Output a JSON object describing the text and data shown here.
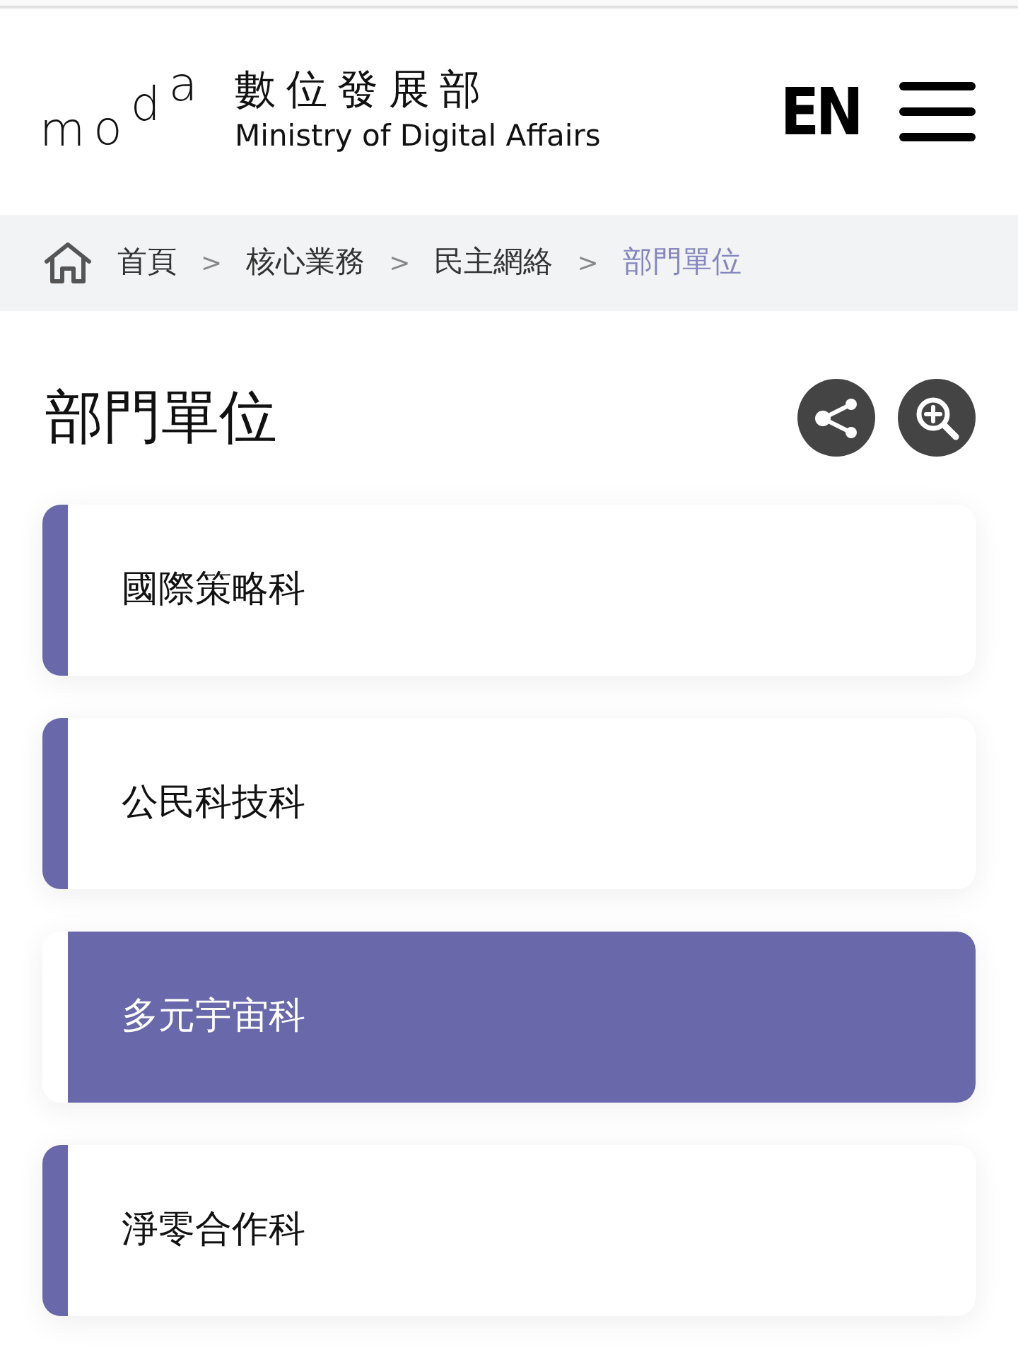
{
  "header": {
    "logo": "moda",
    "title": "數位發展部",
    "subtitle": "Ministry of Digital Affairs",
    "language": "EN"
  },
  "breadcrumb": [
    {
      "label": "首頁",
      "current": false
    },
    {
      "separator": ">",
      "label": "核心業務",
      "current": false
    },
    {
      "separator": ">",
      "label": "民主網絡",
      "current": false
    },
    {
      "separator": ">",
      "label": "部門單位",
      "current": true
    }
  ],
  "page_title": "部門單位",
  "units": [
    {
      "label": "國際策略科",
      "selected": false
    },
    {
      "label": "公民科技科",
      "selected": false
    },
    {
      "label": "多元宇宙科",
      "selected": true
    },
    {
      "label": "淨零合作科",
      "selected": false
    }
  ]
}
